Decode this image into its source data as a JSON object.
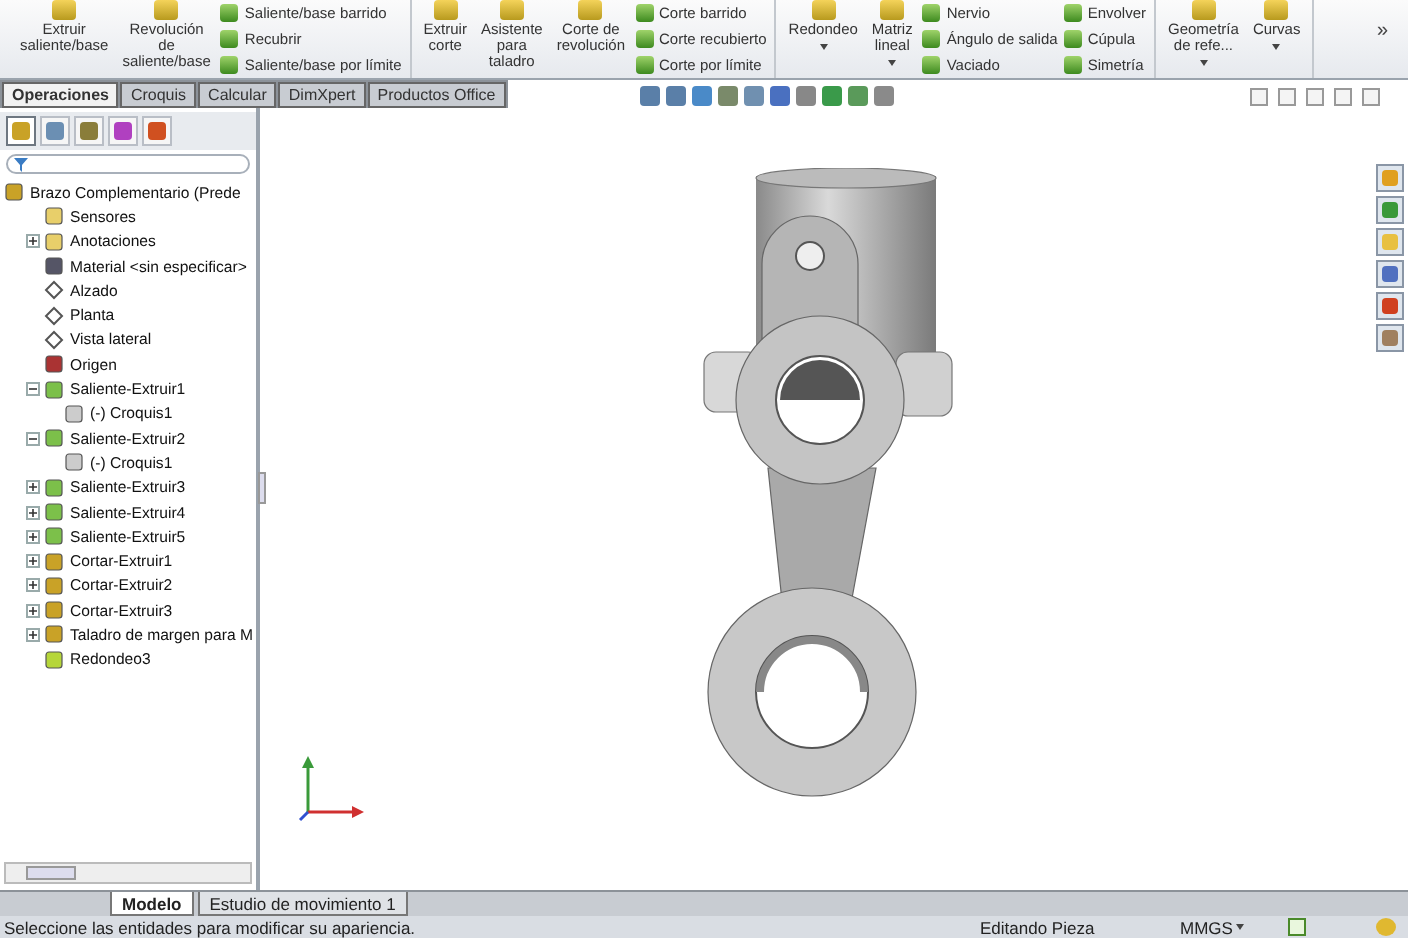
{
  "ribbon": {
    "groups": [
      {
        "large": [
          {
            "lines": [
              "Extruir",
              "saliente/base"
            ],
            "menu": false
          },
          {
            "lines": [
              "Revolución",
              "de",
              "saliente/base"
            ],
            "menu": false
          }
        ],
        "small_columns": [
          [
            "Saliente/base barrido",
            "Recubrir",
            "Saliente/base por límite"
          ]
        ]
      },
      {
        "large": [
          {
            "lines": [
              "Extruir",
              "corte"
            ],
            "menu": false
          },
          {
            "lines": [
              "Asistente",
              "para",
              "taladro"
            ],
            "menu": false
          },
          {
            "lines": [
              "Corte de",
              "revolución"
            ],
            "menu": false
          }
        ],
        "small_columns": [
          [
            "Corte barrido",
            "Corte recubierto",
            "Corte por límite"
          ]
        ]
      },
      {
        "large": [
          {
            "lines": [
              "Redondeo"
            ],
            "menu": true
          },
          {
            "lines": [
              "Matriz",
              "lineal"
            ],
            "menu": true
          }
        ],
        "small_columns": [
          [
            "Nervio",
            "Ángulo de salida",
            "Vaciado"
          ],
          [
            "Envolver",
            "Cúpula",
            "Simetría"
          ]
        ]
      },
      {
        "large": [
          {
            "lines": [
              "Geometría",
              "de refe..."
            ],
            "menu": true
          },
          {
            "lines": [
              "Curvas"
            ],
            "menu": true
          }
        ]
      }
    ],
    "more": "»"
  },
  "command_tabs": [
    {
      "label": "Operaciones",
      "selected": true
    },
    {
      "label": "Croquis",
      "selected": false
    },
    {
      "label": "Calcular",
      "selected": false
    },
    {
      "label": "DimXpert",
      "selected": false
    },
    {
      "label": "Productos Office",
      "selected": false
    }
  ],
  "manager_tabs": [
    {
      "kind": "feature-tree",
      "selected": true
    },
    {
      "kind": "property",
      "selected": false
    },
    {
      "kind": "configuration",
      "selected": false
    },
    {
      "kind": "dimxpert",
      "selected": false
    },
    {
      "kind": "display",
      "selected": false
    }
  ],
  "tree": {
    "label": "Brazo Complementario (Prede",
    "kind": "part",
    "children": [
      {
        "label": "Sensores",
        "kind": "sensor"
      },
      {
        "label": "Anotaciones",
        "kind": "annotation",
        "expanded": false
      },
      {
        "label": "Material <sin especificar>",
        "kind": "material"
      },
      {
        "label": "Alzado",
        "kind": "plane"
      },
      {
        "label": "Planta",
        "kind": "plane"
      },
      {
        "label": "Vista lateral",
        "kind": "plane"
      },
      {
        "label": "Origen",
        "kind": "origin"
      },
      {
        "label": "Saliente-Extruir1",
        "kind": "boss",
        "expanded": true,
        "children": [
          {
            "label": "(-) Croquis1",
            "kind": "sketch"
          }
        ]
      },
      {
        "label": "Saliente-Extruir2",
        "kind": "boss",
        "expanded": true,
        "children": [
          {
            "label": "(-) Croquis1",
            "kind": "sketch"
          }
        ]
      },
      {
        "label": "Saliente-Extruir3",
        "kind": "boss",
        "expanded": false
      },
      {
        "label": "Saliente-Extruir4",
        "kind": "boss",
        "expanded": false
      },
      {
        "label": "Saliente-Extruir5",
        "kind": "boss",
        "expanded": false
      },
      {
        "label": "Cortar-Extruir1",
        "kind": "cut",
        "expanded": false
      },
      {
        "label": "Cortar-Extruir2",
        "kind": "cut",
        "expanded": false
      },
      {
        "label": "Cortar-Extruir3",
        "kind": "cut",
        "expanded": false
      },
      {
        "label": "Taladro de margen para M",
        "kind": "hole",
        "expanded": false
      },
      {
        "label": "Redondeo3",
        "kind": "fillet"
      }
    ]
  },
  "bottom_tabs": [
    {
      "label": "Modelo",
      "selected": true
    },
    {
      "label": "Estudio de movimiento 1",
      "selected": false
    }
  ],
  "status_bar": {
    "message": "Seleccione las entidades para modificar su apariencia.",
    "mode": "Editando Pieza",
    "units": "MMGS"
  }
}
